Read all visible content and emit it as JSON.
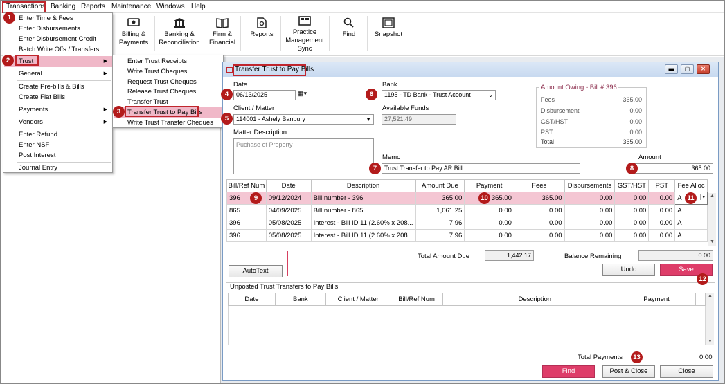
{
  "menubar": [
    "Transactions",
    "Banking",
    "Reports",
    "Maintenance",
    "Windows",
    "Help"
  ],
  "toolbar": [
    {
      "label_1": "Billing &",
      "label_2": "Payments",
      "icon": "billing-icon"
    },
    {
      "label_1": "Banking &",
      "label_2": "Reconciliation",
      "icon": "bank-icon"
    },
    {
      "label_1": "Firm &",
      "label_2": "Financial",
      "icon": "book-icon"
    },
    {
      "label_1": "Reports",
      "label_2": "",
      "icon": "report-icon"
    },
    {
      "label_1": "Practice",
      "label_2": "Management",
      "label_3": "Sync",
      "icon": "sync-icon"
    },
    {
      "label_1": "Find",
      "label_2": "",
      "icon": "search-icon"
    },
    {
      "label_1": "Snapshot",
      "label_2": "",
      "icon": "snapshot-icon"
    }
  ],
  "transactions_menu": [
    "Enter Time & Fees",
    "Enter Disbursements",
    "Enter Disbursement Credit",
    "Batch Write Offs / Transfers",
    "Trust",
    "General",
    "Create Pre-bills & Bills",
    "Create Flat Bills",
    "Payments",
    "Vendors",
    "Enter Refund",
    "Enter NSF",
    "Post Interest",
    "Journal Entry"
  ],
  "trust_menu": [
    "Enter Trust Receipts",
    "Write Trust Cheques",
    "Request Trust Cheques",
    "Release Trust Cheques",
    "Transfer Trust",
    "Transfer Trust to Pay Bills",
    "Write Trust Transfer Cheques"
  ],
  "badges": [
    "1",
    "2",
    "3",
    "4",
    "5",
    "6",
    "7",
    "8",
    "9",
    "10",
    "11",
    "12",
    "13"
  ],
  "window": {
    "title": "Transfer Trust to Pay Bills",
    "date_label": "Date",
    "date_value": "06/13/2025",
    "client_label": "Client / Matter",
    "client_value": "114001 - Ashely Banbury",
    "matter_desc_label": "Matter Description",
    "matter_desc_value": "Puchase of Property",
    "bank_label": "Bank",
    "bank_value": "1195 - TD Bank - Trust Account",
    "funds_label": "Available Funds",
    "funds_value": "27,521.49",
    "owing_title": "Amount Owing - Bill # 396",
    "owing_rows": [
      {
        "label": "Fees",
        "value": "365.00"
      },
      {
        "label": "Disbursement",
        "value": "0.00"
      },
      {
        "label": "GST/HST",
        "value": "0.00"
      },
      {
        "label": "PST",
        "value": "0.00"
      },
      {
        "label": "Total",
        "value": "365.00"
      }
    ],
    "memo_label": "Memo",
    "memo_value": "Trust Transfer to Pay AR Bill",
    "amount_label": "Amount",
    "amount_value": "365.00",
    "grid_headers": [
      "Bill/Ref Num",
      "Date",
      "Description",
      "Amount Due",
      "Payment",
      "Fees",
      "Disbursements",
      "GST/HST",
      "PST",
      "Fee Alloc"
    ],
    "grid_rows": [
      [
        "396",
        "09/12/2024",
        "Bill number - 396",
        "365.00",
        "365.00",
        "365.00",
        "0.00",
        "0.00",
        "0.00",
        "A"
      ],
      [
        "865",
        "04/09/2025",
        "Bill number - 865",
        "1,061.25",
        "0.00",
        "0.00",
        "0.00",
        "0.00",
        "0.00",
        "A"
      ],
      [
        "396",
        "05/08/2025",
        "Interest - Bill ID 11 (2.60% x 208...",
        "7.96",
        "0.00",
        "0.00",
        "0.00",
        "0.00",
        "0.00",
        "A"
      ],
      [
        "396",
        "05/08/2025",
        "Interest - Bill ID 11 (2.60% x 208...",
        "7.96",
        "0.00",
        "0.00",
        "0.00",
        "0.00",
        "0.00",
        "A"
      ]
    ],
    "total_due_label": "Total Amount Due",
    "total_due_value": "1,442.17",
    "balance_label": "Balance Remaining",
    "balance_value": "0.00",
    "autotext": "AutoText",
    "undo": "Undo",
    "save": "Save",
    "unposted_title": "Unposted Trust Transfers to Pay Bills",
    "unposted_headers": [
      "Date",
      "Bank",
      "Client / Matter",
      "Bill/Ref Num",
      "Description",
      "Payment"
    ],
    "total_payments_label": "Total Payments",
    "total_payments_value": "0.00",
    "find": "Find",
    "post_close": "Post & Close",
    "close": "Close"
  },
  "colors": {
    "accent": "#de3d69",
    "badge": "#b31b1b",
    "highlight": "#f4c6d3"
  }
}
